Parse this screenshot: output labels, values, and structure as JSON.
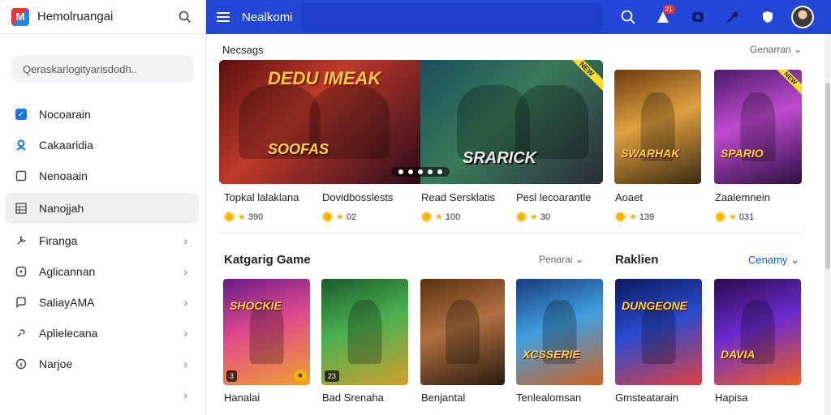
{
  "sidebar": {
    "app_title": "Hemolruangai",
    "search_placeholder": "Qeraskarlogityarisdodh..",
    "items": [
      {
        "label": "Nocoarain",
        "icon": "checkbox-icon",
        "chevron": false
      },
      {
        "label": "Cakaaridia",
        "icon": "person-icon",
        "chevron": false
      },
      {
        "label": "Nenoaain",
        "icon": "square-icon",
        "chevron": false
      },
      {
        "label": "Nanojjah",
        "icon": "grid-icon",
        "chevron": false
      },
      {
        "label": "Firanga",
        "icon": "wrench-icon",
        "chevron": true
      },
      {
        "label": "Aglicannan",
        "icon": "app-icon",
        "chevron": true
      },
      {
        "label": "SaliayAMA",
        "icon": "chat-icon",
        "chevron": true
      },
      {
        "label": "Aplielecana",
        "icon": "link-icon",
        "chevron": true
      },
      {
        "label": "Narjoe",
        "icon": "info-icon",
        "chevron": true
      },
      {
        "label": "",
        "icon": "",
        "chevron": true
      }
    ]
  },
  "topbar": {
    "title": "Nealkomi",
    "notification_count": "21",
    "icons": [
      "search-icon",
      "alert-icon",
      "camera-icon",
      "key-icon",
      "shield-icon",
      "avatar"
    ]
  },
  "section1": {
    "title": "Necsags",
    "sort_label": "Genarran",
    "featured": {
      "text_a": "DEDU IMEAK",
      "text_a2": "SOOFAS",
      "text_b": "SRARICK",
      "tag": "NEW"
    },
    "games": [
      {
        "name": "Topkal lalaklana",
        "rating": "390"
      },
      {
        "name": "Dovidbosslests",
        "rating": "02"
      },
      {
        "name": "Read Sersklatis",
        "rating": "100"
      },
      {
        "name": "Pesl lecoarantle",
        "rating": "30"
      },
      {
        "name": "Aoaet",
        "rating": "139"
      },
      {
        "name": "Zaalemnein",
        "rating": "031"
      }
    ]
  },
  "section2": {
    "title": "Katgarig Game",
    "sort_label": "Penarai",
    "title_b": "Raklien",
    "sort_b": "Cenamy",
    "games": [
      {
        "name": "Hanalai",
        "badge": "3"
      },
      {
        "name": "Bad Srenaha",
        "badge": "23"
      },
      {
        "name": "Benjantal",
        "badge": ""
      },
      {
        "name": "Tenlealomsan",
        "badge": ""
      },
      {
        "name": "Gmsteatarain",
        "badge": ""
      },
      {
        "name": "Hapisa",
        "badge": ""
      }
    ]
  },
  "colors": {
    "topbar": "#2346d6",
    "accent": "#1a73e8",
    "coin": "#f4b400"
  }
}
